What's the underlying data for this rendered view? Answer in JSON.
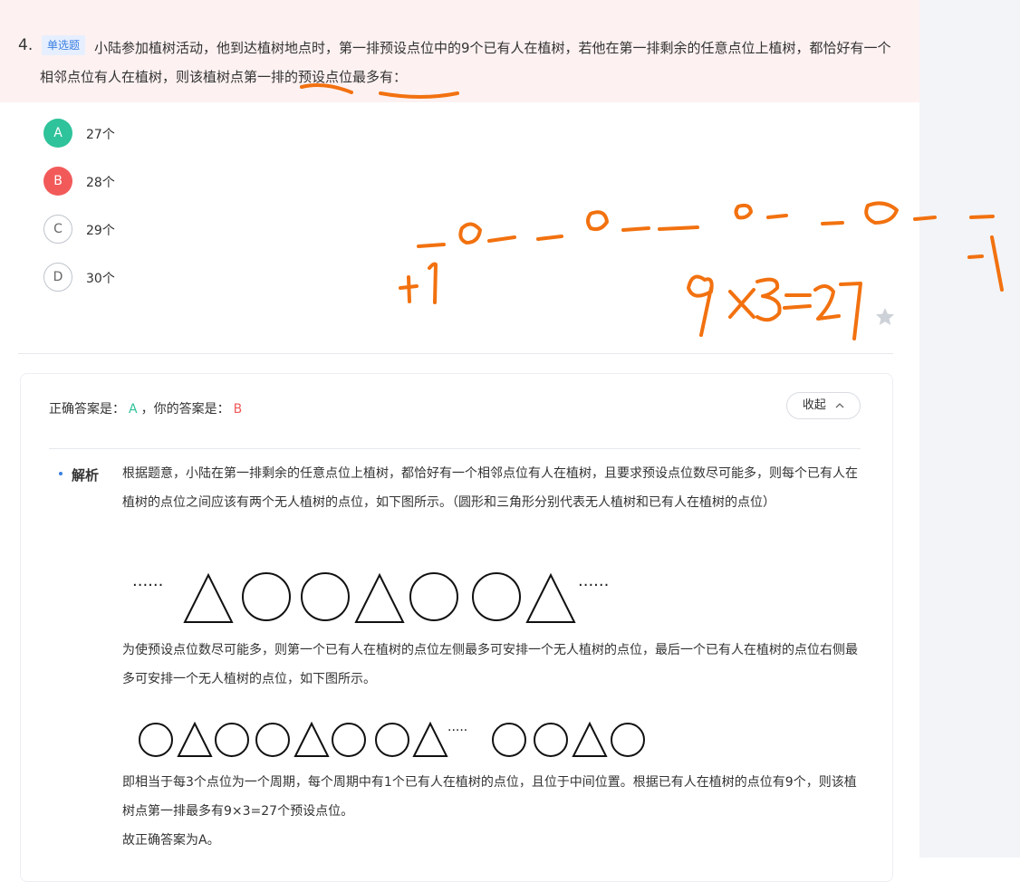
{
  "question": {
    "number": "4.",
    "tag": "单选题",
    "text": "小陆参加植树活动，他到达植树地点时，第一排预设点位中的9个已有人在植树，若他在第一排剩余的任意点位上植树，都恰好有一个相邻点位有人在植树，则该植树点第一排的预设点位最多有："
  },
  "options": [
    {
      "letter": "A",
      "text": "27个",
      "state": "correct"
    },
    {
      "letter": "B",
      "text": "28个",
      "state": "wrong-selected"
    },
    {
      "letter": "C",
      "text": "29个",
      "state": "normal"
    },
    {
      "letter": "D",
      "text": "30个",
      "state": "normal"
    }
  ],
  "answer": {
    "correct_prefix": "正确答案是：",
    "correct_value": "A",
    "yours_prefix": "，你的答案是：",
    "yours_value": "B",
    "collapse_label": "收起",
    "collapse_icon": "chevron-up-icon"
  },
  "explanation": {
    "label": "解析",
    "para1": "根据题意，小陆在第一排剩余的任意点位上植树，都恰好有一个相邻点位有人在植树，且要求预设点位数尽可能多，则每个已有人在植树的点位之间应该有两个无人植树的点位，如下图所示。（圆形和三角形分别代表无人植树和已有人在植树的点位）",
    "para2": "为使预设点位数尽可能多，则第一个已有人在植树的点位左侧最多可安排一个无人植树的点位，最后一个已有人在植树的点位右侧最多可安排一个无人植树的点位，如下图所示。",
    "para3": "即相当于每3个点位为一个周期，每个周期中有1个已有人在植树的点位，且位于中间位置。根据已有人在植树的点位有9个，则该植树点第一排最多有9×3=27个预设点位。",
    "para4": "故正确答案为A。",
    "diagram1": [
      "ellipsis",
      "triangle",
      "circle",
      "circle",
      "triangle",
      "circle",
      "circle",
      "triangle",
      "ellipsis"
    ],
    "diagram2": [
      "circle",
      "triangle",
      "circle",
      "circle",
      "triangle",
      "circle",
      "circle",
      "triangle",
      "ellipsis",
      "circle",
      "circle",
      "triangle",
      "circle"
    ]
  },
  "handwriting": {
    "color": "#f2710f",
    "note_plus": "+1",
    "note_minus": "-1",
    "note_formula": "9x3=27"
  },
  "colors": {
    "correct": "#2ec39a",
    "wrong": "#f25a5a",
    "tag": "#3a7fe0",
    "question_band": "#fdf1f1"
  }
}
